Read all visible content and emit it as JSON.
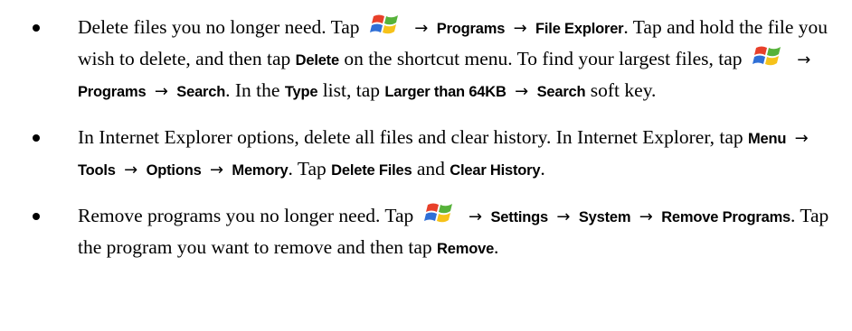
{
  "icons": {
    "start": "windows-start-logo-icon",
    "arrow": "→"
  },
  "colors": {
    "logo_red": "#e8402a",
    "logo_green": "#56b23a",
    "logo_blue": "#2f6fd6",
    "logo_yellow": "#f6c21a"
  },
  "items": [
    {
      "t1": "Delete files you no longer need. Tap",
      "u1": "Programs",
      "u2": "File Explorer",
      "t2": ". Tap and hold the file you wish to delete, and then tap",
      "u3": "Delete",
      "t3": "on the shortcut menu. To find your largest files, tap",
      "u4": "Programs",
      "u5": "Search",
      "t4": ". In the",
      "u6": "Type",
      "t5": "list, tap",
      "u7": "Larger than 64KB",
      "u8": "Search",
      "t6": "soft key."
    },
    {
      "t1": "In Internet Explorer options, delete all files and clear history. In Internet Explorer, tap",
      "u1": "Menu",
      "u2": "Tools",
      "u3": "Options",
      "u4": "Memory",
      "t2": ". Tap",
      "u5": "Delete Files",
      "t3": "and",
      "u6": "Clear History",
      "t4": "."
    },
    {
      "t1": "Remove programs you no longer need. Tap",
      "u1": "Settings",
      "u2": "System",
      "u3": "Remove Programs",
      "t2": ". Tap the program you want to remove and then tap",
      "u4": "Remove",
      "t3": "."
    }
  ]
}
